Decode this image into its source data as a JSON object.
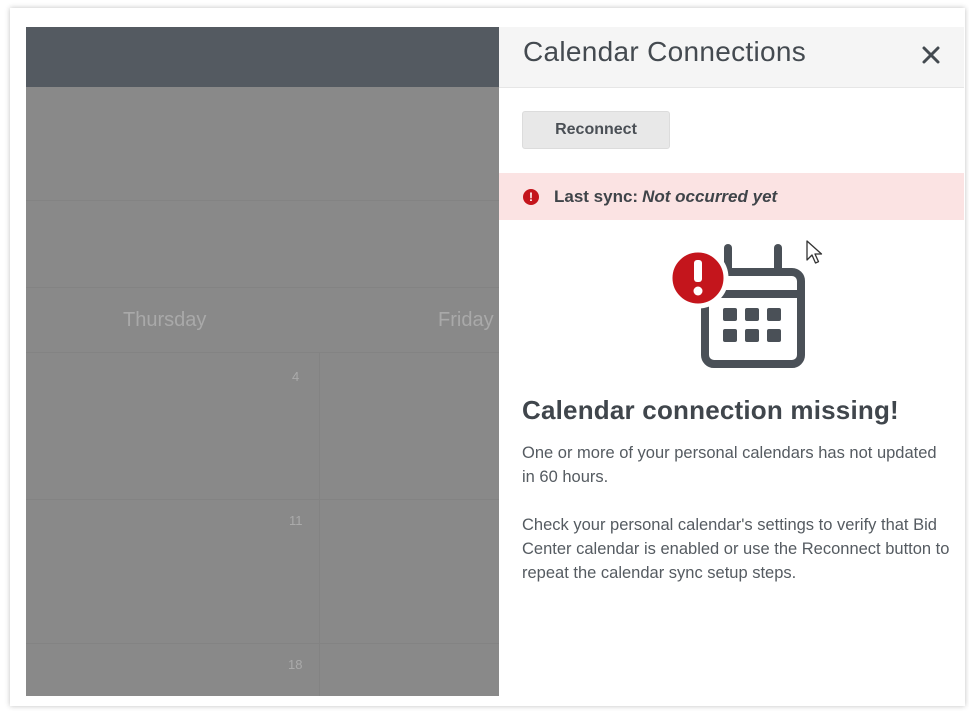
{
  "calendar": {
    "days": [
      "Thursday",
      "Friday"
    ],
    "dates": [
      "4",
      "11",
      "18"
    ]
  },
  "panel": {
    "title": "Calendar Connections",
    "close_icon": "close-icon",
    "reconnect_label": "Reconnect",
    "sync_label": "Last sync:",
    "sync_value": "Not occurred yet",
    "illustration_icon": "calendar-alert-icon",
    "heading": "Calendar connection missing!",
    "paragraph1": "One or more of your personal calendars has not updated in 60 hours.",
    "paragraph2": "Check your personal calendar's settings to verify that Bid Center calendar is enabled or use the Reconnect button to repeat the calendar sync setup steps."
  },
  "colors": {
    "alert_red": "#c4151c",
    "alert_bg": "#fbe3e3",
    "header_dark": "#545a61",
    "overlay_gray": "#898989"
  }
}
